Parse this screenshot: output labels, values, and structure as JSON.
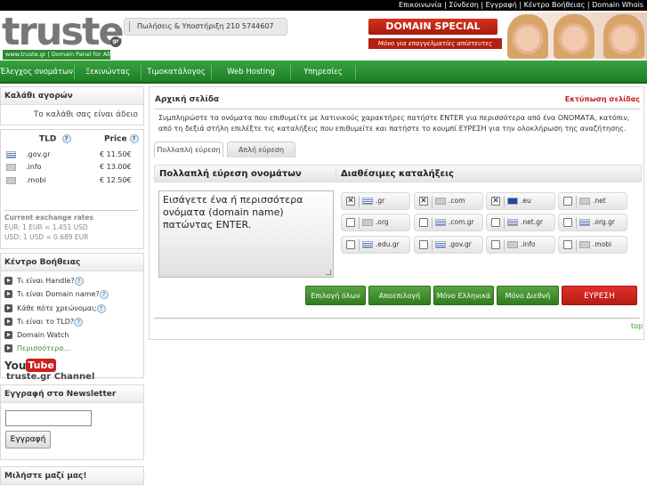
{
  "topbar": {
    "links": [
      "Επικοινωνία",
      "Σύνδεση",
      "Εγγραφή",
      "Κέντρο Βοήθειας",
      "Domain Whois"
    ]
  },
  "logo": {
    "word": "truste",
    "badge": "gr",
    "tagline": "www.truste.gr | Domain Panel for All"
  },
  "phone": "Πωλήσεις & Υποστήριξη 210 5744607",
  "banner": {
    "title": "DOMAIN SPECIAL",
    "subtitle": "Μόνο για επαγγελματίες απίστευτες προσφορές!"
  },
  "nav": {
    "items": [
      "Έλεγχος ονομάτων",
      "Ξεκινώντας",
      "Τιμοκατάλογος",
      "Web Hosting",
      "Υπηρεσίες"
    ]
  },
  "cart": {
    "title": "Καλάθι αγορών",
    "empty": "Το καλάθι σας είναι άδειο"
  },
  "tld_table": {
    "col_tld": "TLD",
    "col_price": "Price",
    "rows": [
      {
        "name": ".gov.gr",
        "price": "€ 11.50€",
        "flag": "gr"
      },
      {
        "name": ".info",
        "price": "€ 13.00€",
        "flag": "generic"
      },
      {
        "name": ".mobi",
        "price": "€ 12.50€",
        "flag": "generic"
      }
    ],
    "exchange_title": "Current exchange rates",
    "eur_usd": "EUR: 1 EUR = 1.451 USD",
    "usd_eur": "USD: 1 USD = 0.689 EUR"
  },
  "help": {
    "title": "Κέντρο Βοήθειας",
    "items": [
      "Τι είναι Handle?",
      "Τι είναι Domain name?",
      "Κάθε πότε χρεώνομαι;",
      "Τι είναι το TLD?",
      "Domain Watch",
      "Περισσότερα..."
    ],
    "youtube_you": "You",
    "youtube_tube": "Tube",
    "youtube_channel": "truste.gr Channel"
  },
  "newsletter": {
    "title": "Εγγραφή στο Newsletter",
    "input_value": "",
    "button": "Εγγραφή"
  },
  "talk": {
    "title": "Μιλήστε μαζί μας!"
  },
  "main": {
    "breadcrumb": "Αρχική σελίδα",
    "print": "Εκτύπωση σελίδας",
    "instructions": "Συμπληρώστε τα ονόματα που επιθυμείτε με λατινικούς χαρακτήρες πατήστε ENTER για περισσότερα από ένα ΟΝΟΜΑΤΑ, κατόπιν, από τη δεξιά στήλη επιλέξτε τις καταλήξεις που επιθυμείτε και πατήστε το κουμπί ΕΥΡΕΣΗ για την ολοκλήρωση της αναζήτησης.",
    "tabs": [
      "Πολλαπλή εύρεση",
      "Απλή εύρεση"
    ],
    "left_header": "Πολλαπλή εύρεση ονομάτων",
    "right_header": "Διαθέσιμες καταλήξεις",
    "textarea_placeholder": "Εισάγετε ένα ή περισσότερα ονόματα (domain name) πατώντας ENTER.",
    "extensions": [
      {
        "label": ".gr",
        "checked": true,
        "flag": "gr"
      },
      {
        "label": ".com",
        "checked": true,
        "flag": "generic"
      },
      {
        "label": ".eu",
        "checked": true,
        "flag": "eu"
      },
      {
        "label": ".net",
        "checked": false,
        "flag": "generic"
      },
      {
        "label": ".org",
        "checked": false,
        "flag": "generic"
      },
      {
        "label": ".com.gr",
        "checked": false,
        "flag": "gr"
      },
      {
        "label": ".net.gr",
        "checked": false,
        "flag": "gr"
      },
      {
        "label": ".org.gr",
        "checked": false,
        "flag": "gr"
      },
      {
        "label": ".edu.gr",
        "checked": false,
        "flag": "gr"
      },
      {
        "label": ".gov.gr",
        "checked": false,
        "flag": "gr"
      },
      {
        "label": ".info",
        "checked": false,
        "flag": "generic"
      },
      {
        "label": ".mobi",
        "checked": false,
        "flag": "generic"
      }
    ],
    "buttons": {
      "select_all": "Επιλογή όλων",
      "deselect_all": "Αποεπιλογή όλων",
      "greek_only": "Μόνο Ελληνικά",
      "intl_only": "Μόνο Διεθνή",
      "search": "ΕΥΡΕΣΗ"
    },
    "top_link": "top"
  }
}
